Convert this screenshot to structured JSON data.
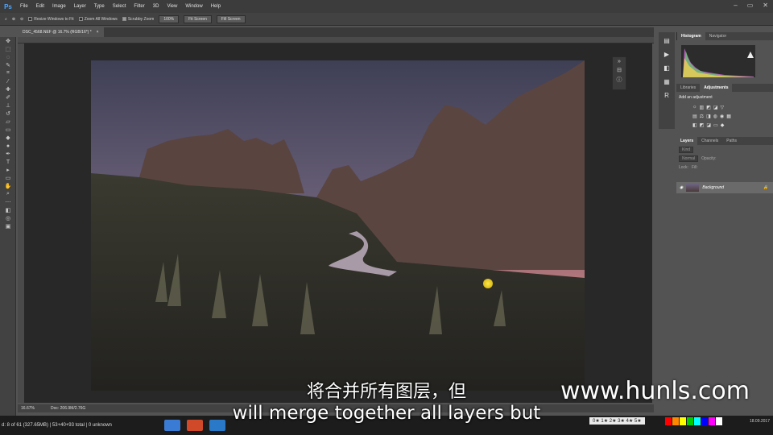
{
  "app": {
    "logo": "Ps",
    "menu": [
      "File",
      "Edit",
      "Image",
      "Layer",
      "Type",
      "Select",
      "Filter",
      "3D",
      "View",
      "Window",
      "Help"
    ]
  },
  "options_bar": {
    "resize_windows": "Resize Windows to Fit",
    "zoom_all": "Zoom All Windows",
    "scrubby_zoom": "Scrubby Zoom",
    "btn_100": "100%",
    "btn_fit": "Fit Screen",
    "btn_fill": "Fill Screen"
  },
  "document": {
    "tab_title": "DSC_4568.NEF @ 16.7% (RGB/16*) *",
    "close": "×"
  },
  "status_bar": {
    "zoom": "16.67%",
    "doc": "Doc: 206.9M/2.76G"
  },
  "right_panels": {
    "top_tabs": [
      "Histogram",
      "Navigator"
    ],
    "adj_tabs": [
      "Libraries",
      "Adjustments"
    ],
    "adj_title": "Add an adjustment",
    "layer_tabs": [
      "Layers",
      "Channels",
      "Paths"
    ],
    "kind": "Kind",
    "blend": "Normal",
    "opacity": "Opacity:",
    "lock": "Lock:",
    "fill": "Fill:",
    "layer_name": "Background"
  },
  "taskbar": {
    "left_text": "d: 8 of 61 (327.65MB) | 53+40+93 total | 0 unknown",
    "date": "18.09.2017",
    "stars": "0★ 1★ 2★ 3★ 4★ 5★"
  },
  "overlay": {
    "subtitle_cn": "将合并所有图层，但",
    "subtitle_en": "will merge together all layers but",
    "watermark": "www.hunls.com"
  },
  "colors": {
    "accent": "#4fa7ff",
    "palette": [
      "#ff0000",
      "#ff8800",
      "#ffff00",
      "#00cc00",
      "#00ffff",
      "#0000ff",
      "#ff00ff",
      "#ffffff"
    ]
  }
}
